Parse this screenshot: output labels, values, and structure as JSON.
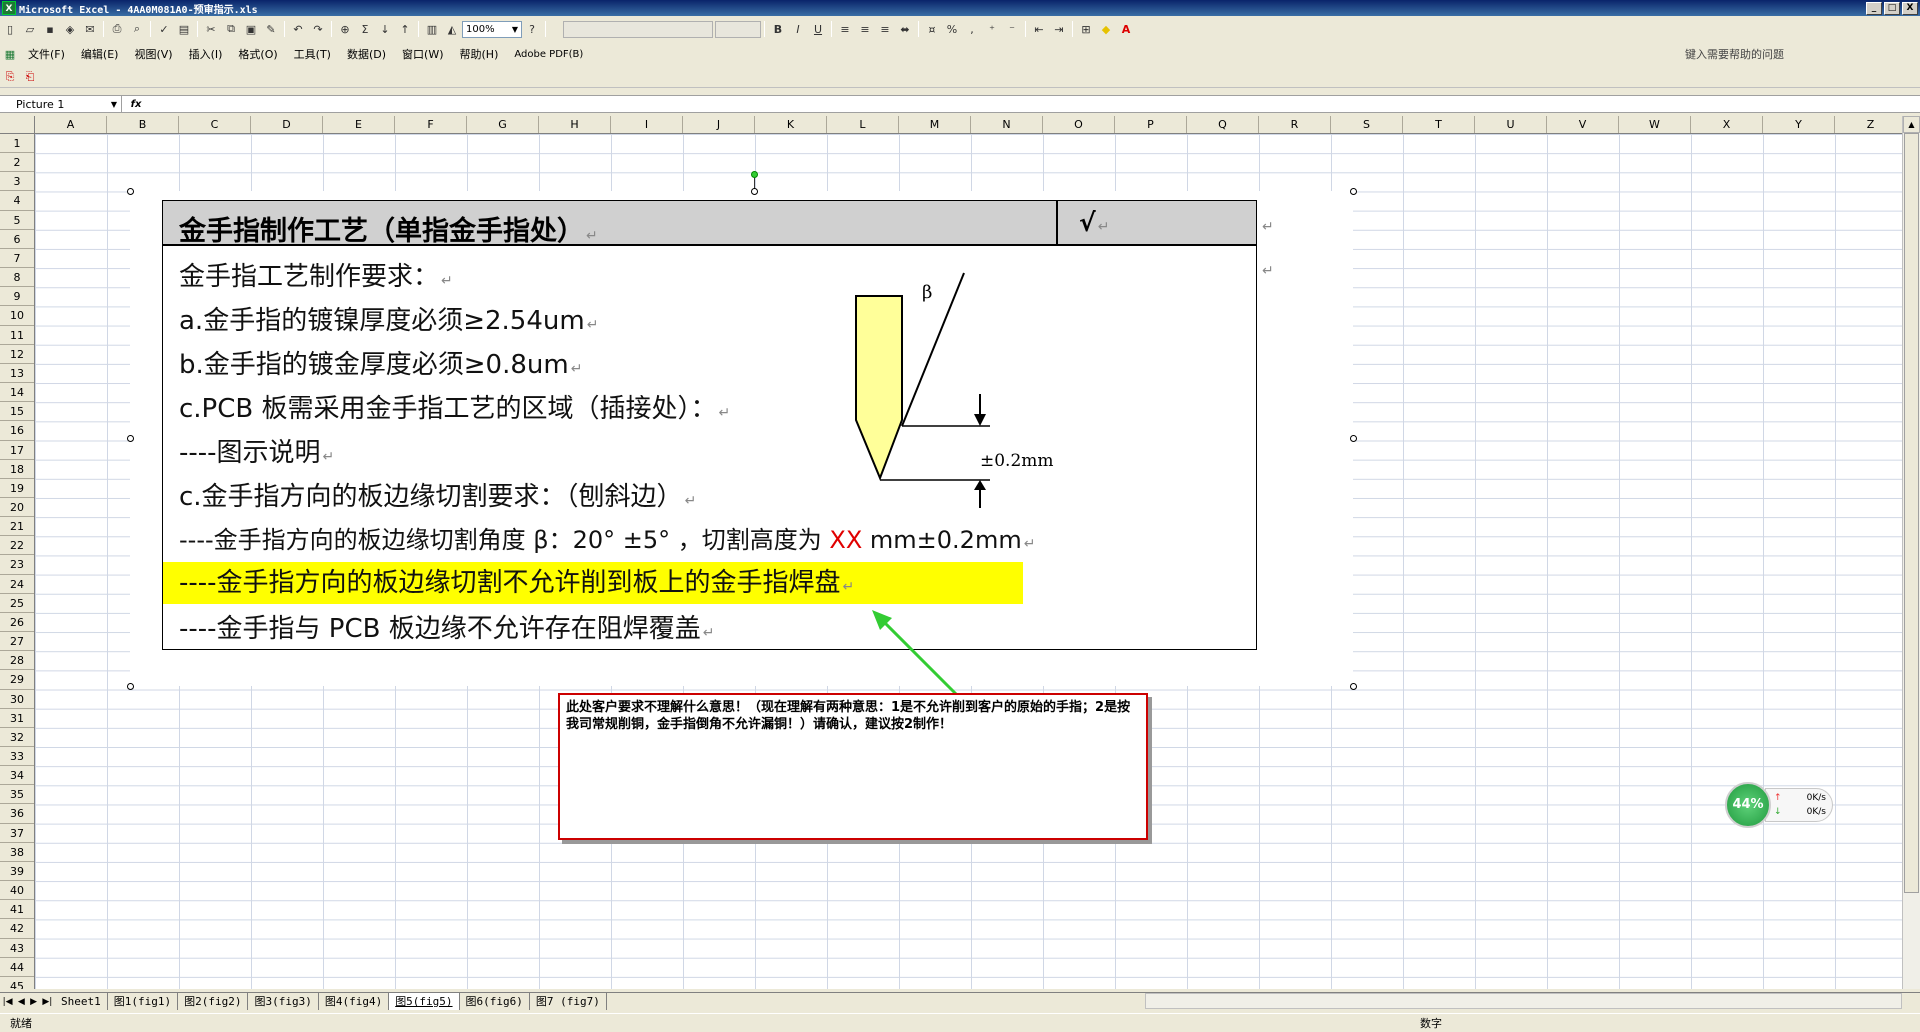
{
  "window": {
    "title": "Microsoft Excel - 4AA0M081A0-预审指示.xls",
    "app_icon": "X",
    "controls": [
      "_",
      "□",
      "X"
    ]
  },
  "toolbar": {
    "zoom": "100%"
  },
  "menubar": {
    "items": [
      "文件(F)",
      "编辑(E)",
      "视图(V)",
      "插入(I)",
      "格式(O)",
      "工具(T)",
      "数据(D)",
      "窗口(W)",
      "帮助(H)",
      "Adobe PDF(B)"
    ],
    "help_placeholder": "键入需要帮助的问题"
  },
  "formula_bar": {
    "name_box": "Picture 1",
    "fx": "fx",
    "formula": ""
  },
  "grid": {
    "columns": [
      "A",
      "B",
      "C",
      "D",
      "E",
      "F",
      "G",
      "H",
      "I",
      "J",
      "K",
      "L",
      "M",
      "N",
      "O",
      "P",
      "Q",
      "R",
      "S",
      "T",
      "U",
      "V",
      "W",
      "X",
      "Y",
      "Z"
    ],
    "rows": [
      "1",
      "2",
      "3",
      "4",
      "5",
      "6",
      "7",
      "8",
      "9",
      "10",
      "11",
      "12",
      "13",
      "14",
      "15",
      "16",
      "17",
      "18",
      "19",
      "20",
      "21",
      "22",
      "23",
      "24",
      "25",
      "26",
      "27",
      "28",
      "29",
      "30",
      "31",
      "32",
      "33",
      "34",
      "35",
      "36",
      "37",
      "38",
      "39",
      "40",
      "41",
      "42",
      "43",
      "44",
      "45"
    ]
  },
  "document": {
    "header_title": "金手指制作工艺（单指金手指处）",
    "header_check": "√",
    "lines": [
      "金手指工艺制作要求：",
      "a.金手指的镀镍厚度必须≥2.54um",
      "b.金手指的镀金厚度必须≥0.8um",
      "c.PCB 板需采用金手指工艺的区域（插接处）：",
      "----图示说明",
      "c.金手指方向的板边缘切割要求：（刨斜边）",
      "----金手指方向的板边缘切割角度 β：20° ±5° ，切割高度为 ",
      "----金手指方向的板边缘切割不允许削到板上的金手指焊盘",
      "----金手指与 PCB 板边缘不允许存在阻焊覆盖"
    ],
    "line7_red": "XX",
    "line7_tail": " mm±0.2mm",
    "diagram_beta": "β",
    "diagram_tolerance": "±0.2mm",
    "return_mark": "↵"
  },
  "comment": {
    "text": "此处客户要求不理解什么意思！（现在理解有两种意思：1是不允许削到客户的原始的手指；2是按我司常规削铜，金手指倒角不允许漏铜！）请确认，建议按2制作！"
  },
  "net_widget": {
    "percent": "44%",
    "up_speed": "0K/s",
    "down_speed": "0K/s"
  },
  "sheet_tabs": {
    "tabs": [
      "Sheet1",
      "图1(fig1)",
      "图2(fig2)",
      "图3(fig3)",
      "图4(fig4)",
      "图5(fig5)",
      "图6(fig6)",
      "图7 (fig7)"
    ],
    "active_index": 5
  },
  "status": {
    "left": "就绪",
    "right": "数字"
  },
  "colors": {
    "highlight": "#ffff00",
    "comment_border": "#cc0000",
    "arrow": "#33cc33",
    "red_text": "#e00000"
  }
}
